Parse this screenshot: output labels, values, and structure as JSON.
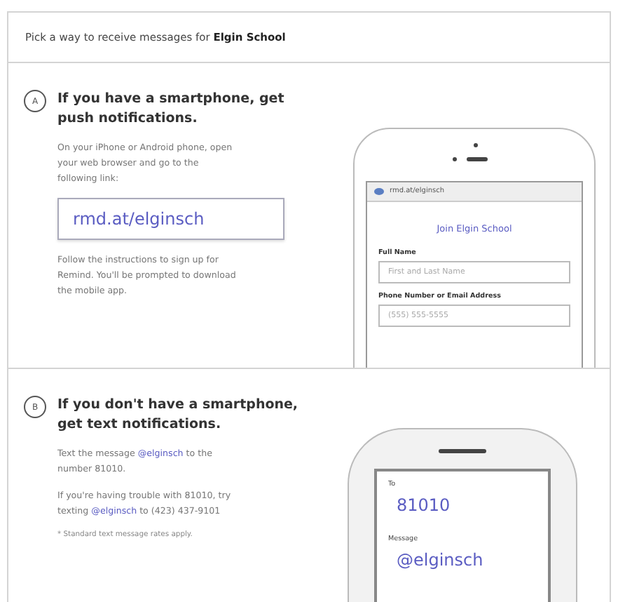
{
  "header": {
    "text": "Pick a way to receive messages for **Elgin School**"
  },
  "options": [
    {
      "kind": "app",
      "letter": "A",
      "title": "If you have a smartphone, get push notifications.",
      "paragraphs": [
        {
          "kind": "body",
          "segments": [
            {
              "text": "On your iPhone or Android phone, open your web browser and go to the following link:",
              "highlight": false
            }
          ]
        },
        {
          "kind": "linkbox",
          "text": "rmd.at/elginsch"
        },
        {
          "kind": "body",
          "segments": [
            {
              "text": "Follow the instructions to sign up for Remind. You'll be prompted to download the mobile app.",
              "highlight": false
            }
          ]
        }
      ],
      "phone": {
        "url": "rmd.at/elginsch",
        "heading": "Join Elgin School",
        "fields": [
          {
            "label": "Full Name",
            "placeholder": "First and Last Name"
          },
          {
            "label": "Phone Number or Email Address",
            "placeholder": "(555) 555-5555"
          }
        ]
      }
    },
    {
      "kind": "sms",
      "letter": "B",
      "title": "If you don't have a smartphone, get text notifications.",
      "paragraphs": [
        {
          "kind": "body",
          "segments": [
            {
              "text": "Text the message ",
              "highlight": false
            },
            {
              "text": "@elginsch",
              "highlight": true
            },
            {
              "text": " to the number 81010.",
              "highlight": false
            }
          ]
        },
        {
          "kind": "body",
          "segments": [
            {
              "text": "If you're having trouble with 81010, try texting ",
              "highlight": false
            },
            {
              "text": "@elginsch",
              "highlight": true
            },
            {
              "text": " to (423) 437-9101",
              "highlight": false
            }
          ]
        },
        {
          "kind": "note",
          "segments": [
            {
              "text": "* Standard text message rates apply.",
              "highlight": false
            }
          ]
        }
      ],
      "phone": {
        "fields": [
          {
            "label": "To",
            "value": "81010"
          },
          {
            "label": "Message",
            "value": "@elginsch"
          }
        ]
      }
    }
  ]
}
